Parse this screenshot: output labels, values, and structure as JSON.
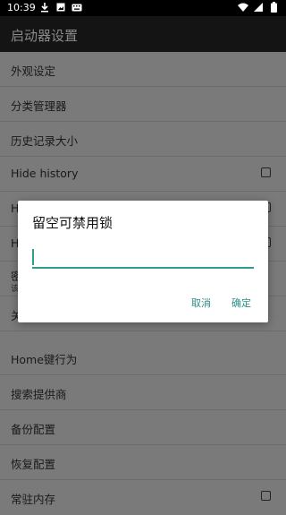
{
  "status_bar": {
    "time": "10:39",
    "left_icons": [
      "download-icon",
      "image-icon",
      "keyboard-icon"
    ],
    "right_icons": [
      "wifi-icon",
      "signal-icon",
      "battery-icon"
    ]
  },
  "toolbar": {
    "title": "启动器设置"
  },
  "settings": {
    "items": [
      {
        "label": "外观设定"
      },
      {
        "label": "分类管理器"
      },
      {
        "label": "历史记录大小"
      },
      {
        "label": "Hide history",
        "checked": false
      },
      {
        "label": "H",
        "checked": false
      },
      {
        "label": "H",
        "checked": false
      },
      {
        "label": "密",
        "sub": "该"
      },
      {
        "label": "关于"
      },
      {
        "label": "Home键行为"
      },
      {
        "label": "搜索提供商"
      },
      {
        "label": "备份配置"
      },
      {
        "label": "恢复配置"
      },
      {
        "label": "常驻内存",
        "checked": false
      }
    ]
  },
  "dialog": {
    "title": "留空可禁用锁",
    "input_value": "",
    "cancel_label": "取消",
    "ok_label": "确定",
    "accent_color": "#2e9e8f"
  }
}
